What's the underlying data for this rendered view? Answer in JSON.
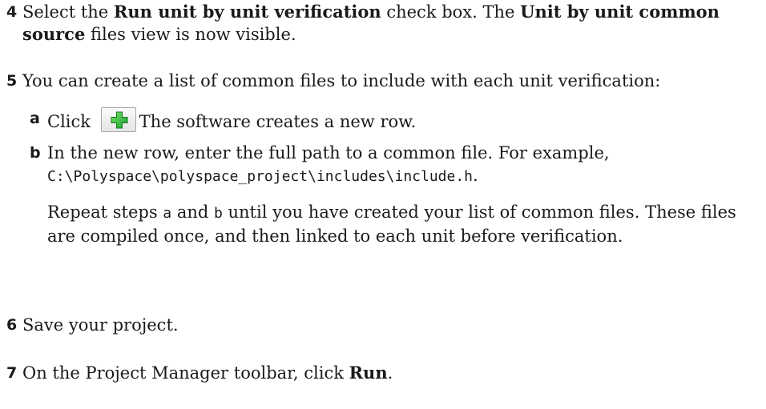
{
  "steps": [
    {
      "number": "4",
      "parts": [
        "Select the ",
        "Run unit by unit verification",
        " check box. The ",
        "Unit by unit common source",
        " files view is now visible."
      ]
    },
    {
      "number": "5",
      "text": "You can create a list of common files to include with each unit verification:",
      "substeps": [
        {
          "letter": "a",
          "before": "Click ",
          "icon": "green-plus-add-icon",
          "after": "The software creates a new row."
        },
        {
          "letter": "b",
          "text": "In the new row, enter the full path to a common file. For example,",
          "code": "C:\\Polyspace\\polyspace_project\\includes\\include.h",
          "code_suffix": "."
        }
      ],
      "note": {
        "before": "Repeat steps ",
        "ref_a": "a",
        "mid": " and ",
        "ref_b": "b",
        "after": " until you have created your list of common files. These files are compiled once, and then linked to each unit before verification."
      }
    },
    {
      "number": "6",
      "text": "Save your project."
    },
    {
      "number": "7",
      "before": "On the Project Manager toolbar, click ",
      "bold": "Run",
      "after": "."
    }
  ]
}
